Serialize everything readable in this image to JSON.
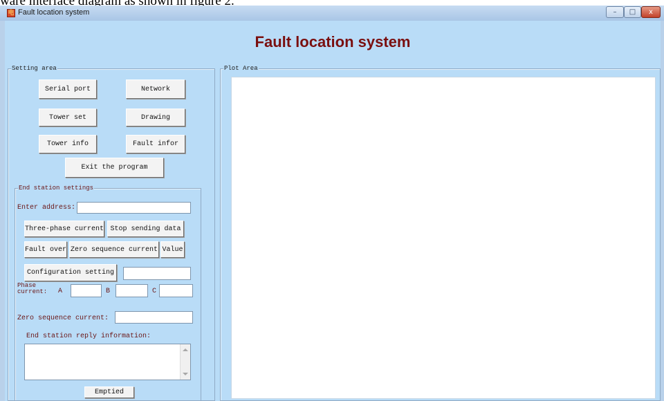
{
  "caption": "ware interface diagram as shown in figure 2.",
  "window": {
    "title": "Fault location system",
    "app_icon_glyph": "电",
    "controls": {
      "minimize": "–",
      "maximize": "□",
      "close": "x"
    }
  },
  "app_title": "Fault location system",
  "setting_area": {
    "legend": "Setting area",
    "buttons": {
      "serial_port": "Serial port",
      "network": "Network",
      "tower_set": "Tower set",
      "drawing": "Drawing",
      "tower_info": "Tower info",
      "fault_infor": "Fault infor",
      "exit": "Exit the program"
    }
  },
  "end_station": {
    "legend": "End station settings",
    "enter_address_label": "Enter address:",
    "enter_address_value": "",
    "buttons": {
      "three_phase_current": "Three-phase current",
      "stop_sending_data": "Stop sending  data",
      "fault_over": "Fault over",
      "zero_sequence_current": "Zero sequence current",
      "value": "Value",
      "configuration_setting": "Configuration setting",
      "emptied": "Emptied"
    },
    "configuration_value": "",
    "phase_label_line1": "Phase",
    "phase_label_line2": "current:",
    "phase_a_label": "A",
    "phase_b_label": "B",
    "phase_c_label": "C",
    "phase_a_value": "",
    "phase_b_value": "",
    "phase_c_value": "",
    "zero_sequence_label": "Zero sequence current:",
    "zero_sequence_value": "",
    "reply_label": "End station reply information:",
    "reply_text": ""
  },
  "plot_area": {
    "legend": "Plot Area"
  },
  "colors": {
    "window_frame": "#b9d1ea",
    "client_background": "#b9dcf7",
    "app_title": "#7a0f0f",
    "label_text": "#6a1414"
  },
  "icons": {
    "app": "app-icon",
    "minimize": "minimize-icon",
    "maximize": "maximize-icon",
    "close": "close-icon",
    "scroll_up": "scroll-up-arrow-icon",
    "scroll_down": "scroll-down-arrow-icon"
  }
}
